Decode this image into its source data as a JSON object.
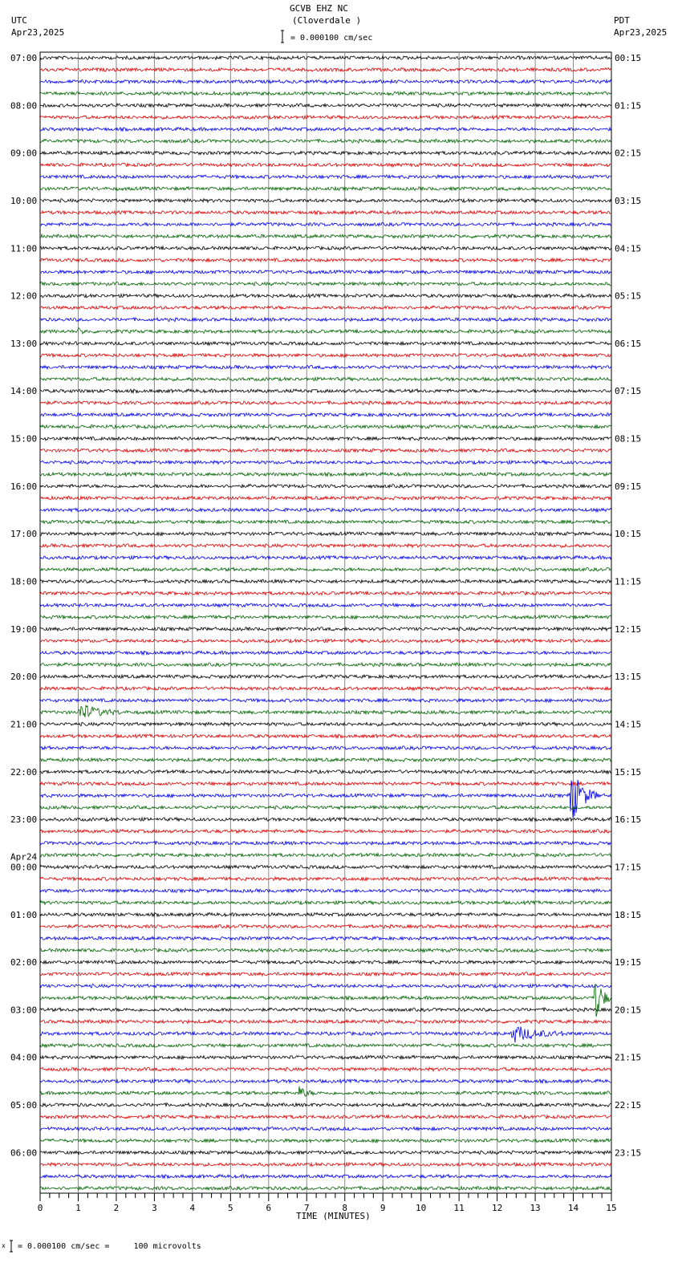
{
  "header": {
    "station": "GCVB EHZ NC",
    "location": "(Cloverdale )",
    "scale": "= 0.000100 cm/sec",
    "left_tz": "UTC",
    "left_date": "Apr23,2025",
    "right_tz": "PDT",
    "right_date": "Apr23,2025"
  },
  "footer": {
    "scale_note": "= 0.000100 cm/sec =     100 microvolts",
    "prefix": "x"
  },
  "chart_data": {
    "type": "line",
    "title": "GCVB EHZ NC (Cloverdale )",
    "xlabel": "TIME (MINUTES)",
    "xlim": [
      0,
      15
    ],
    "xticks": [
      "0",
      "1",
      "2",
      "3",
      "4",
      "5",
      "6",
      "7",
      "8",
      "9",
      "10",
      "11",
      "12",
      "13",
      "14",
      "15"
    ],
    "traces_per_hour": 4,
    "trace_count": 96,
    "trace_colors": [
      "#000000",
      "#dd0000",
      "#0000ee",
      "#006400"
    ],
    "left_labels": [
      "07:00",
      "08:00",
      "09:00",
      "10:00",
      "11:00",
      "12:00",
      "13:00",
      "14:00",
      "15:00",
      "16:00",
      "17:00",
      "18:00",
      "19:00",
      "20:00",
      "21:00",
      "22:00",
      "23:00",
      "00:00",
      "01:00",
      "02:00",
      "03:00",
      "04:00",
      "05:00",
      "06:00"
    ],
    "date_change_label": "Apr24",
    "right_labels": [
      "00:15",
      "01:15",
      "02:15",
      "03:15",
      "04:15",
      "05:15",
      "06:15",
      "07:15",
      "08:15",
      "09:15",
      "10:15",
      "11:15",
      "12:15",
      "13:15",
      "14:15",
      "15:15",
      "16:15",
      "17:15",
      "18:15",
      "19:15",
      "20:15",
      "21:15",
      "22:15",
      "23:15"
    ],
    "events": [
      {
        "trace": 23,
        "start_min": 1.0,
        "duration_min": 0.3,
        "amplitude": 5
      },
      {
        "trace": 55,
        "start_min": 1.0,
        "duration_min": 1.2,
        "amplitude": 12
      },
      {
        "trace": 62,
        "start_min": 13.9,
        "duration_min": 0.8,
        "amplitude": 42
      },
      {
        "trace": 79,
        "start_min": 14.55,
        "duration_min": 0.45,
        "amplitude": 40
      },
      {
        "trace": 82,
        "start_min": 12.35,
        "duration_min": 1.6,
        "amplitude": 12
      },
      {
        "trace": 87,
        "start_min": 6.75,
        "duration_min": 0.5,
        "amplitude": 10
      }
    ]
  }
}
